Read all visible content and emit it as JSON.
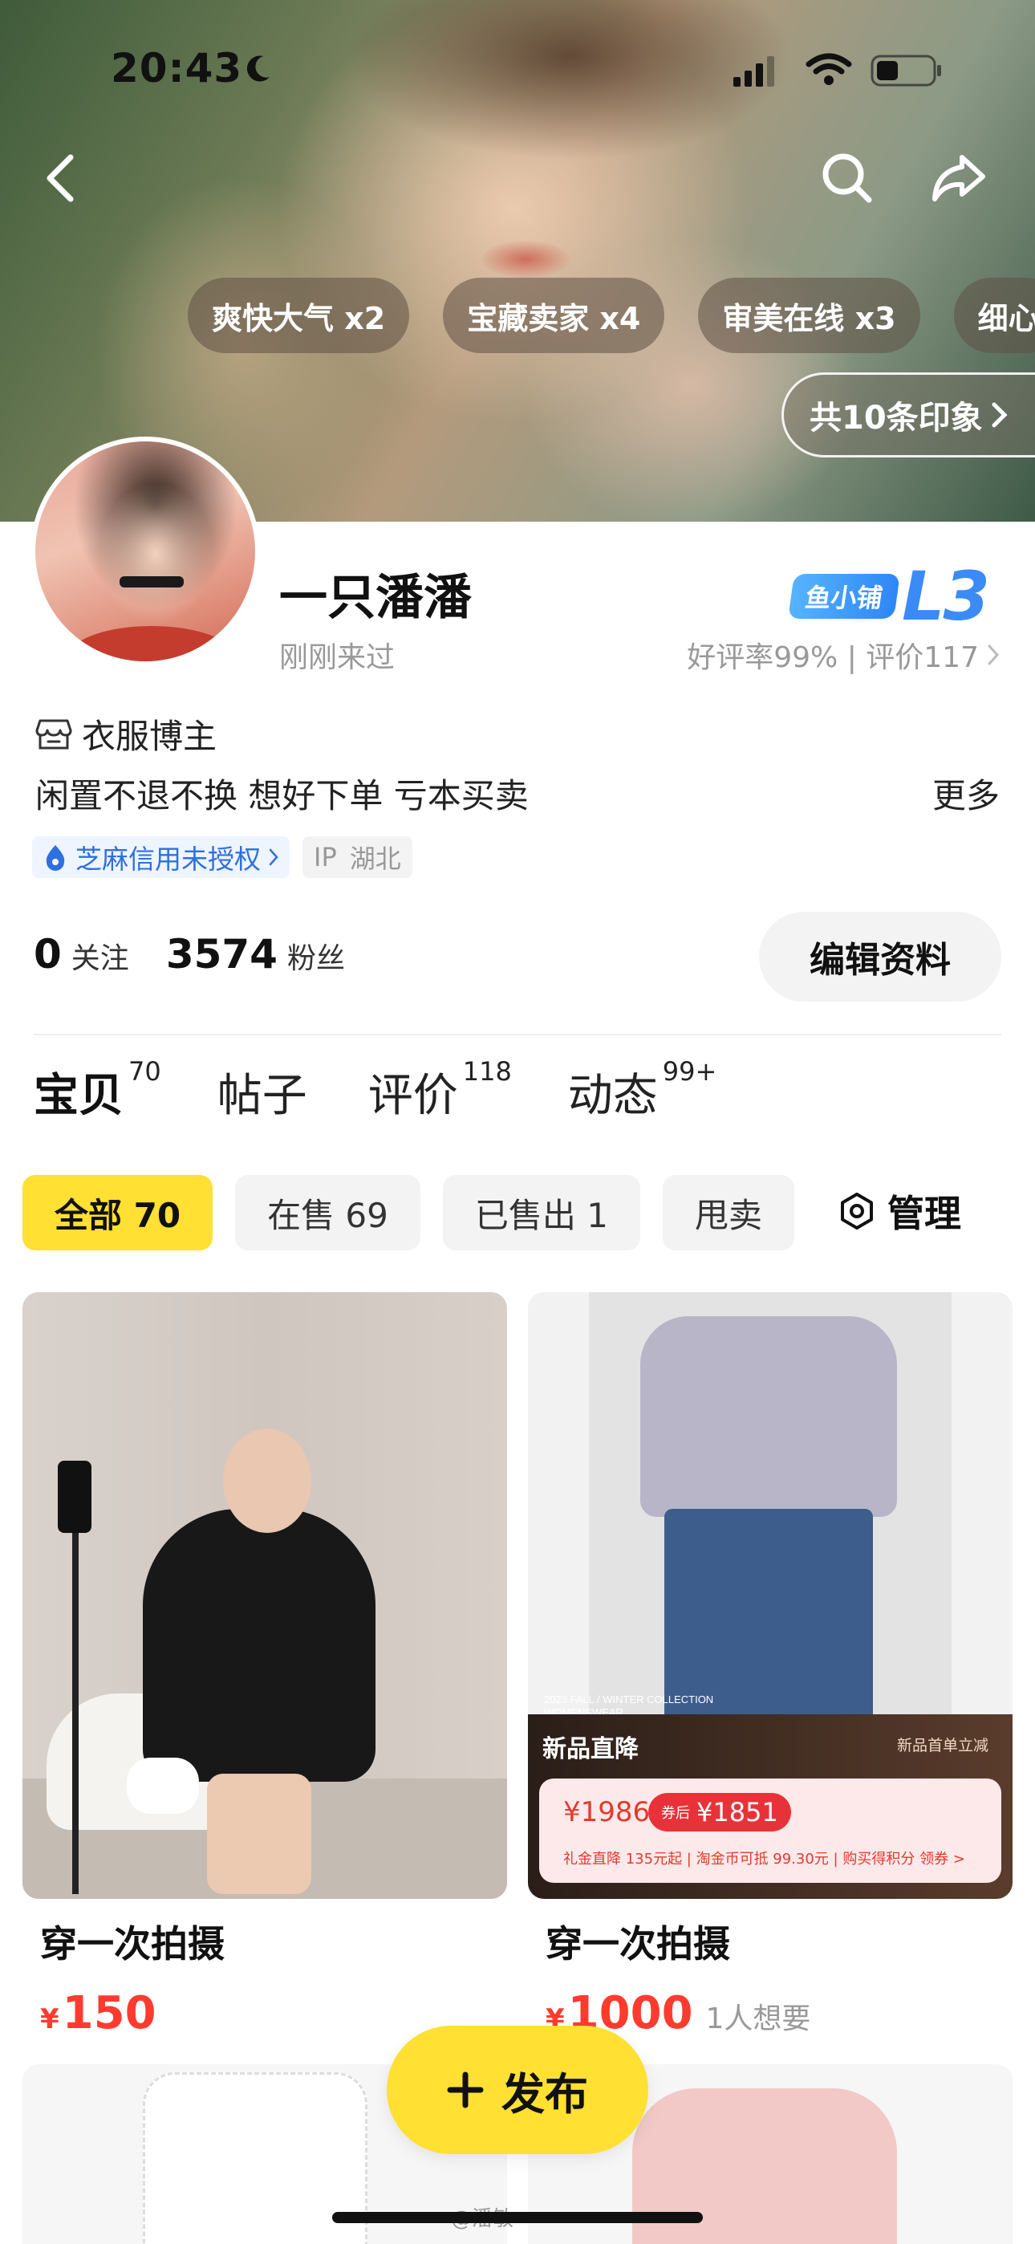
{
  "status_bar": {
    "time": "20:43"
  },
  "header": {
    "tags": [
      "爽快大气 x2",
      "宝藏卖家 x4",
      "审美在线 x3",
      "细心"
    ],
    "impressions_label": "共10条印象"
  },
  "profile": {
    "username": "一只潘潘",
    "last_seen": "刚刚来过",
    "shop_badge": "鱼小铺",
    "shop_level": "L3",
    "rating": "好评率99% | 评价117",
    "role": "衣服博主",
    "bio": "闲置不退不换 想好下单 亏本买卖",
    "more": "更多",
    "sesame": "芝麻信用未授权",
    "ip_label": "IP",
    "ip_location": "湖北",
    "following_count": "0",
    "following_label": "关注",
    "fans_count": "3574",
    "fans_label": "粉丝",
    "edit_button": "编辑资料"
  },
  "tabs": [
    {
      "label": "宝贝",
      "count": "70"
    },
    {
      "label": "帖子",
      "count": ""
    },
    {
      "label": "评价",
      "count": "118"
    },
    {
      "label": "动态",
      "count": "99+"
    }
  ],
  "filters": [
    "全部 70",
    "在售 69",
    "已售出 1",
    "甩卖"
  ],
  "manage_label": "管理",
  "items": [
    {
      "title": "穿一次拍摄",
      "currency": "¥",
      "price": "150",
      "wants": ""
    },
    {
      "title": "穿一次拍摄",
      "currency": "¥",
      "price": "1000",
      "wants": "1人想要"
    }
  ],
  "promo": {
    "collection_line1": "2023 FALL / WINTER COLLECTION",
    "collection_line2": "WOMENSWEAR",
    "title": "新品直降",
    "subtitle": "新品首单立减",
    "original_price": "¥1986",
    "coupon_label": "券后",
    "coupon_price": "¥1851",
    "detail": "礼金直降 135元起 | 淘金币可抵 99.30元 | 购买得积分    领券 >"
  },
  "publish_label": "发布",
  "watermark": "@潘敏",
  "colors": {
    "accent": "#ffe033",
    "price": "#ff3b2f",
    "link_blue": "#2f6fe0"
  }
}
